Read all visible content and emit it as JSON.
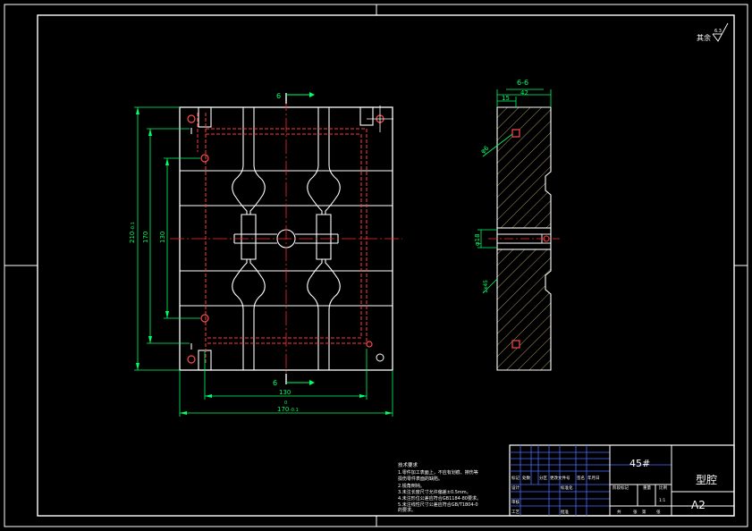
{
  "drawing": {
    "section_mark_top": "6",
    "section_mark_bottom": "6",
    "section_title": "6-6",
    "dims": {
      "overall_height": "210",
      "overall_height_tol": "-0.1",
      "height_170": "170",
      "height_130": "130",
      "width_130": "130",
      "overall_width": "170",
      "overall_width_tol": "-0.1",
      "tol_plus": "0",
      "thickness": "42",
      "offset_15": "15",
      "hole_dia": "φ6",
      "bore_dia": "φ18",
      "chamfer": "1x45"
    },
    "roughness": {
      "other": "其余",
      "value": "6.3"
    }
  },
  "notes": {
    "title": "技术要求",
    "lines": [
      "1.零件加工表面上，不应有划痕、擦伤等",
      "  损伤零件表面的缺陷。",
      "2.锐角倒钝。",
      "3.未注长度尺寸允许偏差±0.5mm。",
      "4.未注形位公差应符合GB1184-80要求。",
      "5.未注线性尺寸公差应符合GB/T1804-0",
      "  的要求。"
    ]
  },
  "title_block": {
    "material": "45#",
    "part_name": "型腔",
    "sheet_size": "A2",
    "labels": {
      "mark": "标记",
      "count": "处数",
      "zone": "分区",
      "change_doc": "更改文件号",
      "sign": "签名",
      "date": "年月日",
      "design": "设计",
      "standardize": "标准化",
      "stage_mark": "阶段标记",
      "weight": "重量",
      "scale": "比例",
      "review": "审核",
      "process": "工艺",
      "approve": "批准",
      "total": "共",
      "sheet": "张",
      "of": "第",
      "sheet2": "张"
    },
    "scale_value": "1:1"
  }
}
